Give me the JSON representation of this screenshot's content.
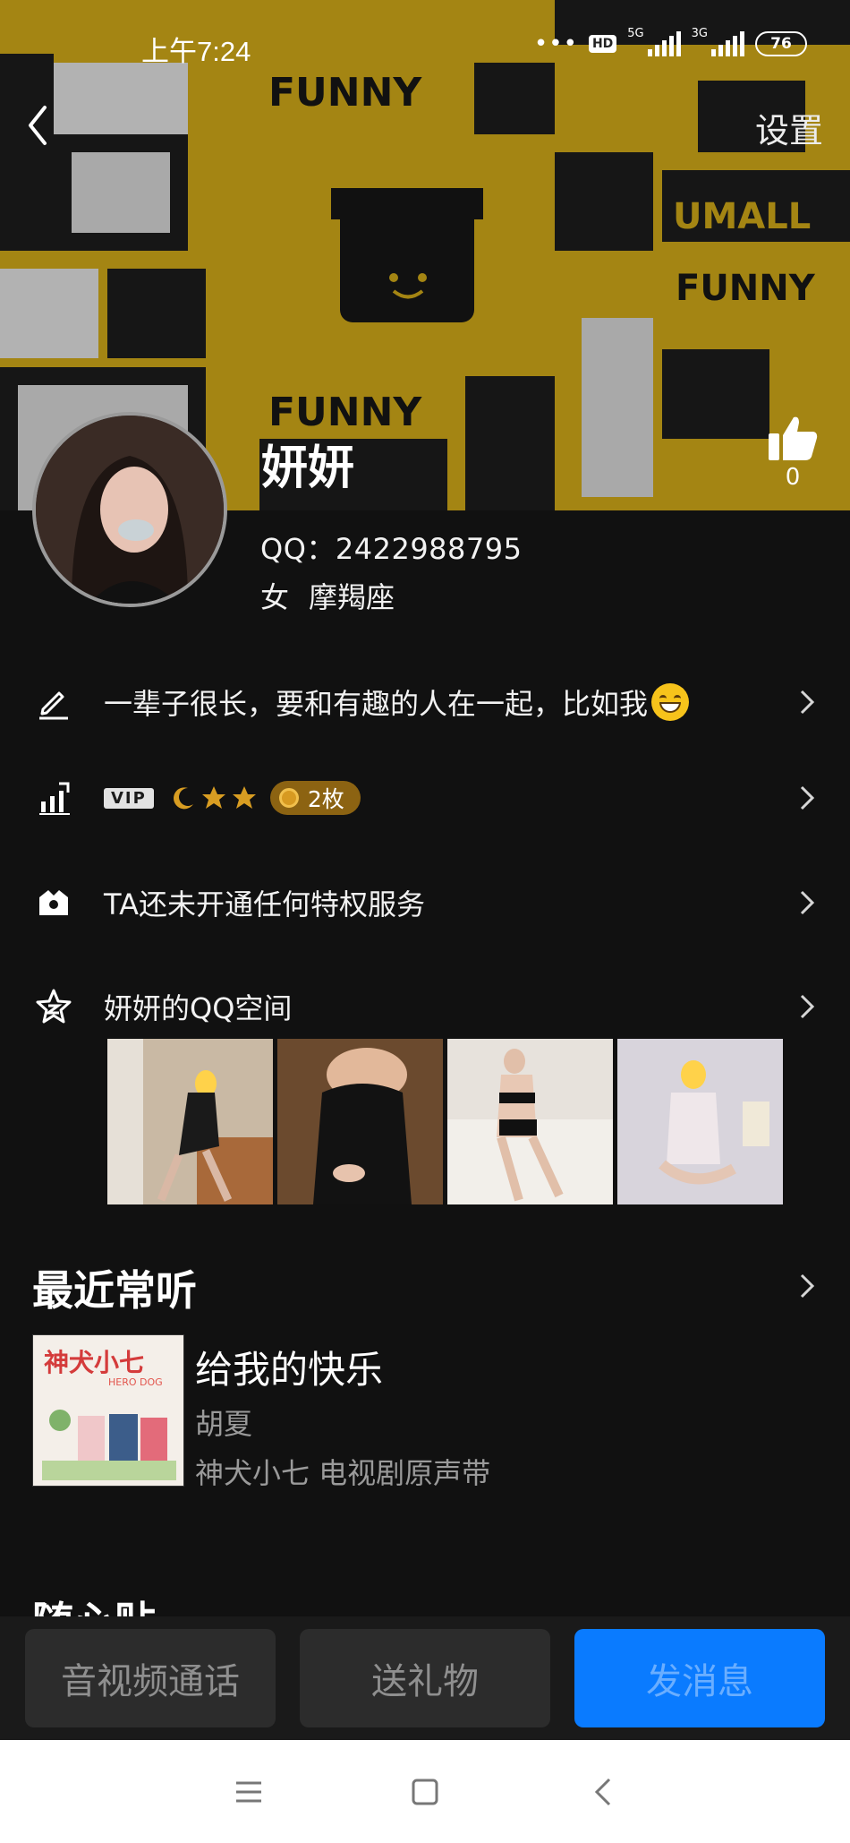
{
  "statusbar": {
    "time": "上午7:24",
    "dots": "•••",
    "hd": "HD",
    "net1": "5G",
    "net2": "3G",
    "battery": "76"
  },
  "header": {
    "settings_label": "设置",
    "cover_words": [
      "FUNNY",
      "UMALL",
      "FUNNY",
      "FUNNY"
    ]
  },
  "profile": {
    "name": "妍妍",
    "like_count": "0",
    "qq_line": "QQ：2422988795",
    "gender": "女",
    "zodiac": "摩羯座"
  },
  "rows": {
    "signature": "一辈子很长，要和有趣的人在一起，比如我",
    "vip_label": "VIP",
    "coin_count": "2枚",
    "privilege": "TA还未开通任何特权服务",
    "qzone": "妍妍的QQ空间"
  },
  "recent": {
    "title": "最近常听",
    "song_title": "给我的快乐",
    "artist": "胡夏",
    "album": "神犬小七 电视剧原声带",
    "cover_text": "神犬小七",
    "cover_sub": "HERO DOG"
  },
  "next_section_title": "随心贴",
  "actions": {
    "call": "音视频通话",
    "gift": "送礼物",
    "message": "发消息"
  },
  "colors": {
    "accent": "#0a7bff",
    "cover_yellow": "#c9a318",
    "background": "#111111"
  },
  "icons": [
    "back-arrow-icon",
    "thumbs-up-icon",
    "edit-pencil-icon",
    "level-chart-icon",
    "privilege-crown-icon",
    "qzone-star-icon",
    "chevron-right-icon"
  ]
}
